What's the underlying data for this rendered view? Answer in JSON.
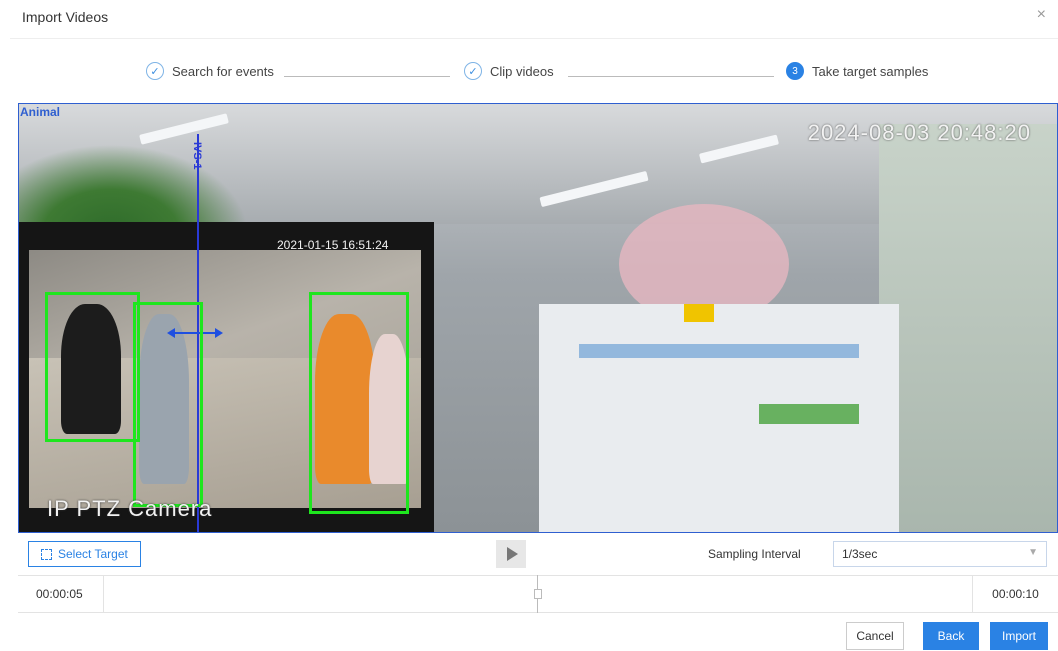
{
  "dialog": {
    "title": "Import Videos",
    "close_glyph": "×"
  },
  "steps": [
    {
      "label": "Search for events",
      "state": "done",
      "mark": "✓"
    },
    {
      "label": "Clip videos",
      "state": "done",
      "mark": "✓"
    },
    {
      "label": "Take target samples",
      "state": "active",
      "mark": "3"
    }
  ],
  "video": {
    "rule_label": "Animal",
    "osd_timestamp": "2024-08-03 20:48:20",
    "inner_timestamp": "2021-01-15 16:51:24",
    "camera_label": "IP PTZ Camera",
    "rule_line_label": "IVS-1",
    "detection_box_color": "#1ee61e",
    "rule_line_color": "#2a3ad6"
  },
  "toolbar": {
    "select_target_label": "Select Target",
    "select_target_icon": "select-region-icon",
    "play_icon": "play-icon",
    "sampling_label": "Sampling Interval",
    "sampling_value": "1/3sec"
  },
  "timeline": {
    "start": "00:00:05",
    "end": "00:00:10"
  },
  "footer": {
    "cancel": "Cancel",
    "back": "Back",
    "import": "Import"
  },
  "colors": {
    "accent": "#2a82e4"
  }
}
